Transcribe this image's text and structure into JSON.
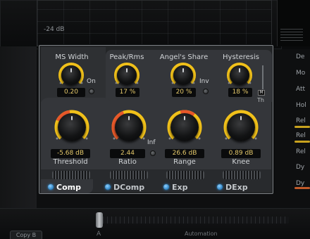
{
  "background": {
    "grid_label": "-24 dB",
    "right_items": [
      "De",
      "Mo",
      "Att",
      "Hol",
      "Rel",
      "Rel",
      "Rel",
      "Dy",
      "Dy"
    ],
    "copy_button": "Copy B",
    "slider_label": "A",
    "automation_label": "Automation"
  },
  "panel": {
    "ms_width": {
      "label": "MS Width",
      "value": "0.20",
      "toggle_label": "On"
    },
    "peak_rms": {
      "label": "Peak/Rms",
      "value": "17 %"
    },
    "angels_share": {
      "label": "Angel's Share",
      "value": "20 %",
      "toggle_label": "Inv"
    },
    "hysteresis": {
      "label": "Hysteresis",
      "value": "18 %",
      "m_label": "M",
      "th_label": "Th"
    },
    "threshold": {
      "label": "Threshold",
      "value": "-5.68 dB"
    },
    "ratio": {
      "label": "Ratio",
      "value": "2.44",
      "toggle_label": "Inf"
    },
    "range": {
      "label": "Range",
      "value": "26.6 dB"
    },
    "knee": {
      "label": "Knee",
      "value": "0.89 dB"
    },
    "tabs": [
      {
        "label": "Comp",
        "active": true
      },
      {
        "label": "DComp",
        "active": false
      },
      {
        "label": "Exp",
        "active": false
      },
      {
        "label": "DExp",
        "active": false
      }
    ]
  },
  "colors": {
    "accent_yellow": "#f2c21a",
    "accent_orange": "#e8582a",
    "value_text": "#e4c86a",
    "led_blue": "#2f8fd8"
  }
}
